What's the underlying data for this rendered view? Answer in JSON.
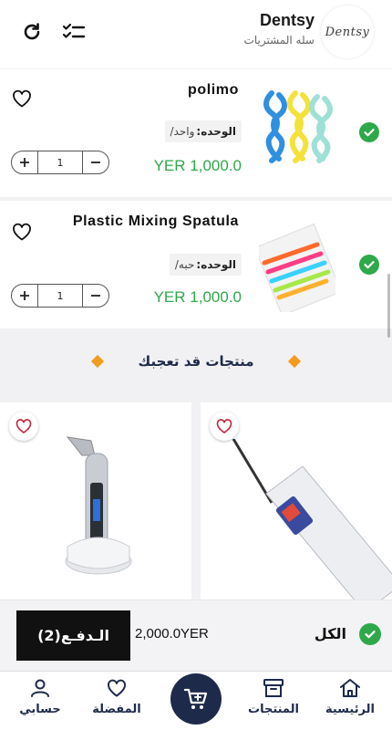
{
  "header": {
    "brand_name": "Dentsy",
    "subtitle": "سله المشتريات",
    "logo_text": "Dentsy",
    "refresh_icon": "refresh-icon",
    "checklist_icon": "checklist-icon"
  },
  "cart": {
    "items": [
      {
        "title": "polimo",
        "unit_label": "الوحده:",
        "unit_value": "واحد/",
        "price": "YER 1,000.0",
        "quantity": "1",
        "selected": true
      },
      {
        "title": "Plastic Mixing Spatula",
        "unit_label": "الوحده:",
        "unit_value": "حبه/",
        "price": "YER 1,000.0",
        "quantity": "1",
        "selected": true
      }
    ]
  },
  "suggestions": {
    "title": "منتجات قد تعجبك"
  },
  "checkout": {
    "pay_label": "الـدفـع(2)",
    "total_value": "2,000.0YER",
    "total_label": "الكل"
  },
  "nav": {
    "home": "الرئيسية",
    "products": "المنتجات",
    "favorites": "المفضلة",
    "account": "حسابي"
  },
  "colors": {
    "accent_green": "#2ea84a",
    "navy": "#1e2a4a",
    "diamond_orange": "#f39b1e"
  }
}
